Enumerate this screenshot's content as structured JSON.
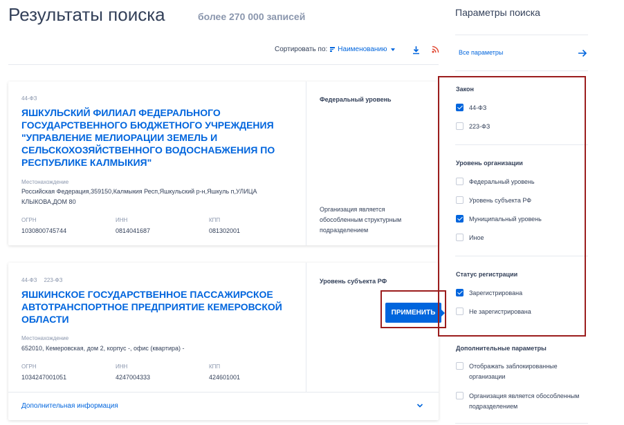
{
  "header": {
    "title": "Результаты поиска",
    "count": "более 270 000 записей"
  },
  "sort": {
    "label": "Сортировать по:",
    "value": "Наименованию"
  },
  "icons": {
    "sort": "sort-lines-icon",
    "download": "download-icon",
    "rss": "rss-icon",
    "chevron": "chevron-down-icon",
    "arrow": "arrow-right-icon"
  },
  "colors": {
    "accent": "#0065dd",
    "text": "#334059",
    "muted": "#8a96ad",
    "highlight": "#9b1c1c"
  },
  "results": [
    {
      "tags": [
        "44-ФЗ"
      ],
      "name": "ЯШКУЛЬСКИЙ ФИЛИАЛ ФЕДЕРАЛЬНОГО ГОСУДАРСТВЕННОГО БЮДЖЕТНОГО УЧРЕЖДЕНИЯ \"УПРАВЛЕНИЕ МЕЛИОРАЦИИ ЗЕМЕЛЬ И СЕЛЬСКОХОЗЯЙСТВЕННОГО ВОДОСНАБЖЕНИЯ ПО РЕСПУБЛИКЕ КАЛМЫКИЯ\"",
      "location_label": "Местонахождение",
      "location": "Российская Федерация,359150,Калмыкия Респ,Яшкульский р-н,Яшкуль п,УЛИЦА КЛЫКОВА,ДОМ 80",
      "ogrn_label": "ОГРН",
      "ogrn": "1030800745744",
      "inn_label": "ИНН",
      "inn": "0814041687",
      "kpp_label": "КПП",
      "kpp": "081302001",
      "level": "Федеральный уровень",
      "note": "Организация является обособленным структурным подразделением"
    },
    {
      "tags": [
        "44-ФЗ",
        "223-ФЗ"
      ],
      "name": "ЯШКИНСКОЕ ГОСУДАРСТВЕННОЕ ПАССАЖИРСКОЕ АВТОТРАНСПОРТНОЕ ПРЕДПРИЯТИЕ КЕМЕРОВСКОЙ ОБЛАСТИ",
      "location_label": "Местонахождение",
      "location": "652010, Кемеровская, дом 2, корпус -, офис (квартира) -",
      "ogrn_label": "ОГРН",
      "ogrn": "1034247001051",
      "inn_label": "ИНН",
      "inn": "4247004333",
      "kpp_label": "КПП",
      "kpp": "424601001",
      "level": "Уровень субъекта РФ",
      "more_info": "Дополнительная информация"
    }
  ],
  "apply_button": "ПРИМЕНИТЬ",
  "sidebar": {
    "title": "Параметры поиска",
    "all_params": "Все параметры",
    "sections": [
      {
        "title": "Закон",
        "options": [
          {
            "label": "44-ФЗ",
            "checked": true
          },
          {
            "label": "223-ФЗ",
            "checked": false
          }
        ]
      },
      {
        "title": "Уровень организации",
        "options": [
          {
            "label": "Федеральный уровень",
            "checked": false
          },
          {
            "label": "Уровень субъекта РФ",
            "checked": false
          },
          {
            "label": "Муниципальный уровень",
            "checked": true
          },
          {
            "label": "Иное",
            "checked": false
          }
        ]
      },
      {
        "title": "Статус регистрации",
        "options": [
          {
            "label": "Зарегистрирована",
            "checked": true
          },
          {
            "label": "Не зарегистрирована",
            "checked": false
          }
        ]
      },
      {
        "title": "Дополнительные параметры",
        "options": [
          {
            "label": "Отображать заблокированные организации",
            "checked": false
          },
          {
            "label": "Организация является обособленным подразделением",
            "checked": false
          }
        ]
      }
    ]
  }
}
